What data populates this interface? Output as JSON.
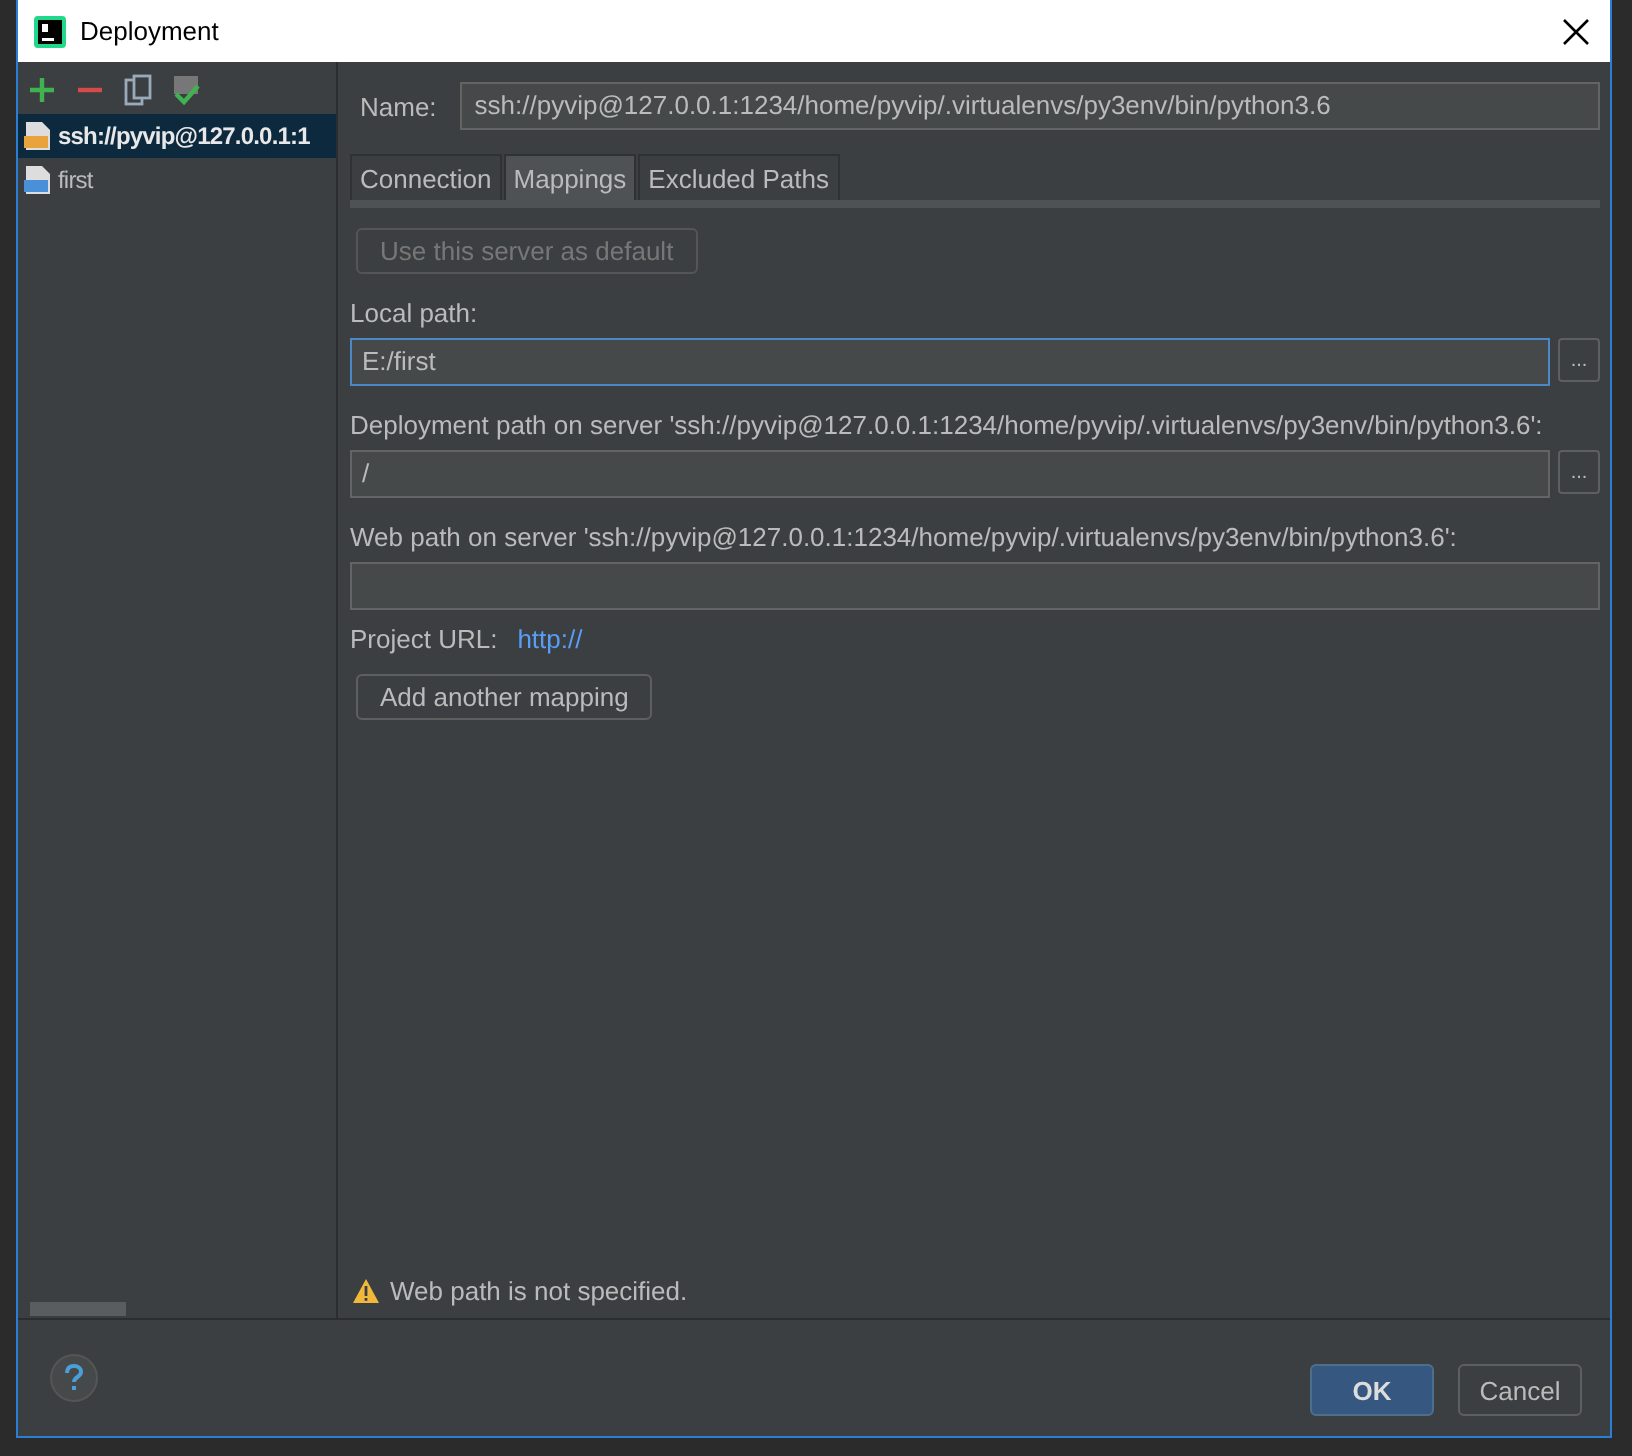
{
  "window": {
    "title": "Deployment"
  },
  "servers": [
    {
      "label": "ssh://pyvip@127.0.0.1:1",
      "selected": true
    },
    {
      "label": "first",
      "selected": false
    }
  ],
  "name": {
    "label": "Name:",
    "value": "ssh://pyvip@127.0.0.1:1234/home/pyvip/.virtualenvs/py3env/bin/python3.6"
  },
  "tabs": [
    {
      "label": "Connection",
      "selected": false
    },
    {
      "label": "Mappings",
      "selected": true
    },
    {
      "label": "Excluded Paths",
      "selected": false
    }
  ],
  "default_button": {
    "label": "Use this server as default",
    "disabled": true
  },
  "fields": [
    {
      "label": "Local path:",
      "value": "E:/first",
      "focused": true,
      "browse": "..."
    },
    {
      "label": "Deployment path on server 'ssh://pyvip@127.0.0.1:1234/home/pyvip/.virtualenvs/py3env/bin/python3.6':",
      "value": "/",
      "focused": false,
      "browse": "..."
    },
    {
      "label": "Web path on server 'ssh://pyvip@127.0.0.1:1234/home/pyvip/.virtualenvs/py3env/bin/python3.6':",
      "focused": false
    }
  ],
  "project_url": {
    "label": "Project URL:",
    "link": "http://"
  },
  "add_mapping_button": "Add another mapping",
  "warning": "Web path is not specified.",
  "buttons": [
    {
      "label": "OK",
      "kind": "default"
    },
    {
      "label": "Cancel",
      "kind": "normal"
    }
  ]
}
